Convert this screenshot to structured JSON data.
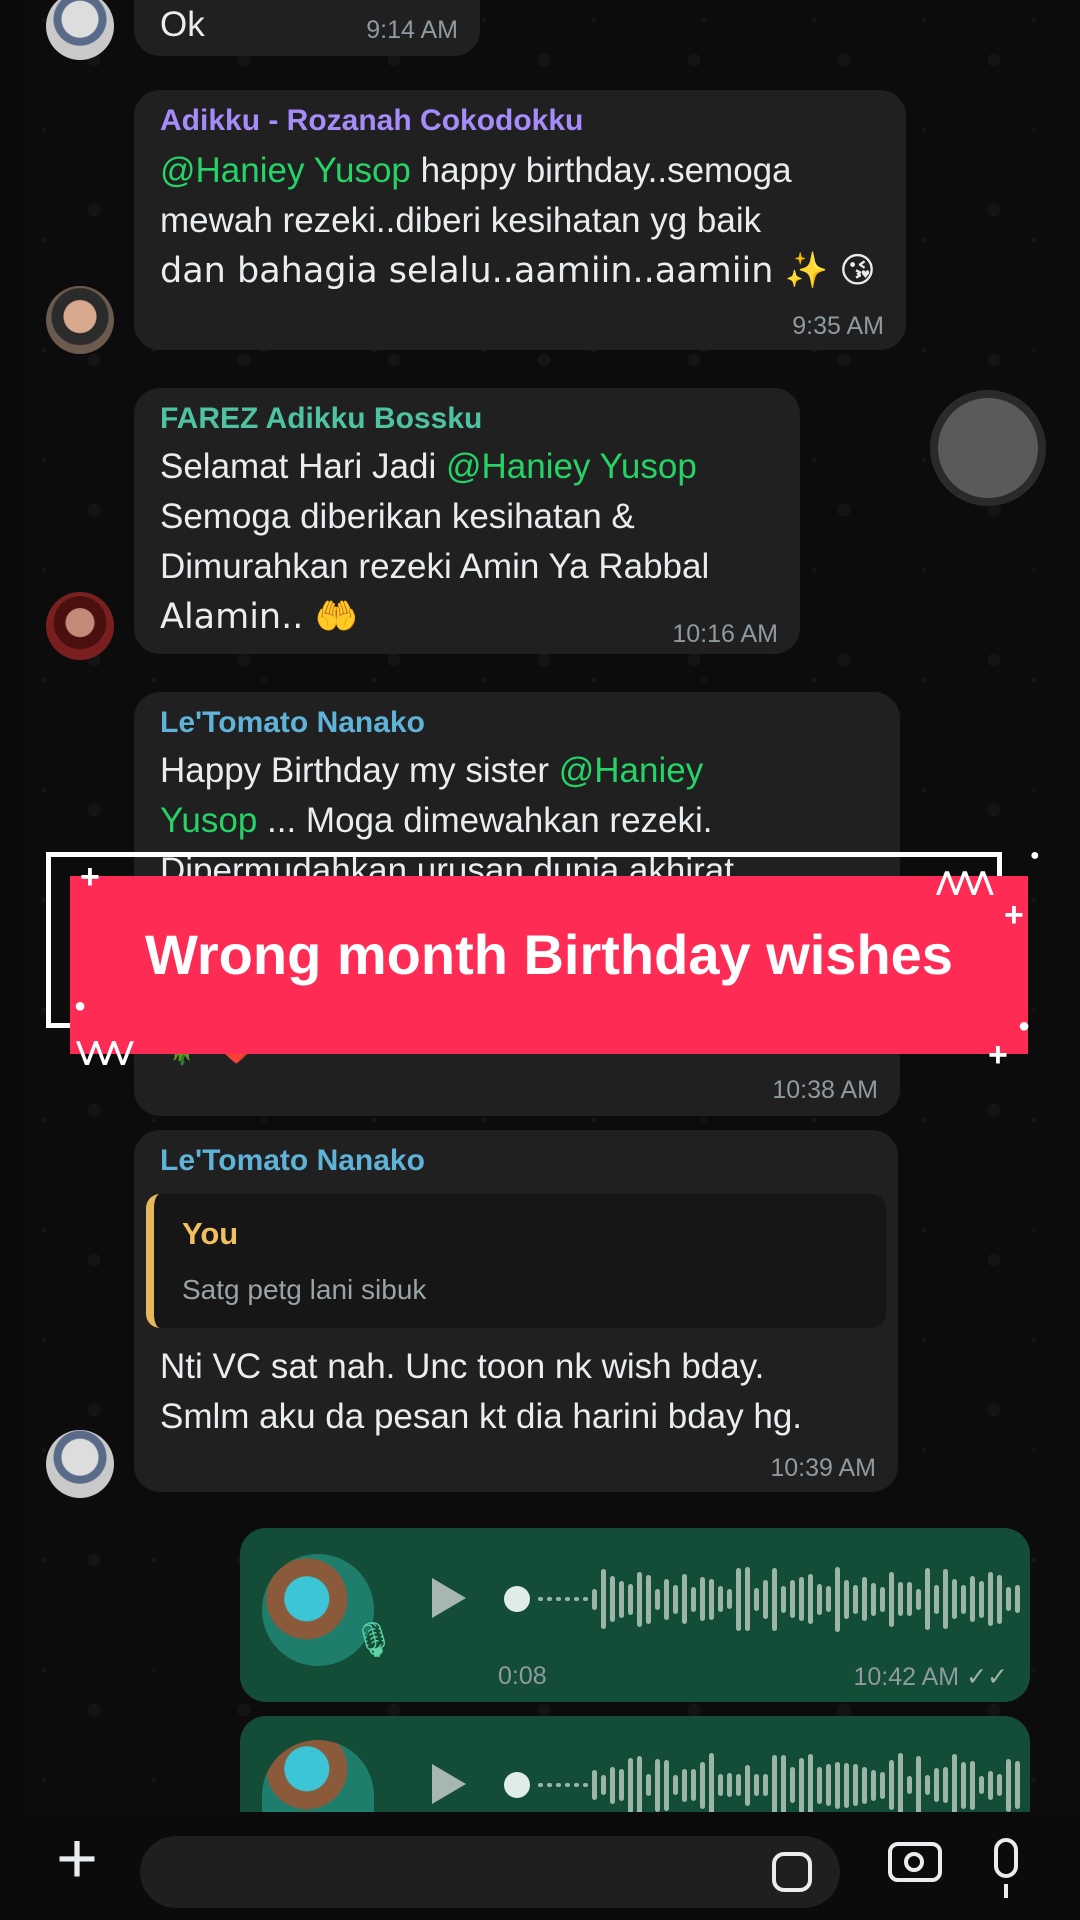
{
  "messages": [
    {
      "text": "Ok",
      "time": "9:14 AM"
    },
    {
      "sender": "Adikku - Rozanah Cokodokku",
      "sender_color": "#a78bfa",
      "line1_mention": "@Haniey Yusop",
      "line1_rest": " happy birthday..semoga",
      "line2": "mewah rezeki..diberi kesihatan yg baik",
      "line3": "dan bahagia selalu..aamiin..aamiin ✨ 😘",
      "time": "9:35 AM"
    },
    {
      "sender": "FAREZ Adikku Bossku",
      "sender_color": "#4fc3a1",
      "line1_pre": "Selamat Hari Jadi ",
      "line1_mention": "@Haniey Yusop",
      "line2": "Semoga diberikan kesihatan &",
      "line3": "Dimurahkan rezeki Amin Ya Rabbal",
      "line4": "Alamin.. 🤲",
      "time": "10:16 AM"
    },
    {
      "sender": "Le'Tomato Nanako",
      "sender_color": "#5fb3d9",
      "line1_pre": "Happy Birthday my sister ",
      "line1_mention": "@Haniey",
      "line2_mention": "Yusop",
      "line2_rest": " ... Moga dimewahkan rezeki.",
      "line3": "Dipermudahkan urusan dunia akhirat",
      "line_last": "🌹 ❤️",
      "time": "10:38 AM"
    },
    {
      "sender": "Le'Tomato Nanako",
      "sender_color": "#5fb3d9",
      "quote_name": "You",
      "quote_text": "Satg petg lani sibuk",
      "line1": "Nti VC sat nah. Unc toon nk wish bday.",
      "line2": "Smlm aku da pesan kt dia harini bday hg.",
      "time": "10:39 AM"
    }
  ],
  "voice_notes": [
    {
      "duration": "0:08",
      "time": "10:42 AM",
      "ticks": "✓✓"
    },
    {
      "duration": "",
      "time": "",
      "ticks": ""
    }
  ],
  "banner": {
    "text": "Wrong month Birthday wishes"
  },
  "composer": {
    "plus": "+",
    "placeholder": ""
  }
}
